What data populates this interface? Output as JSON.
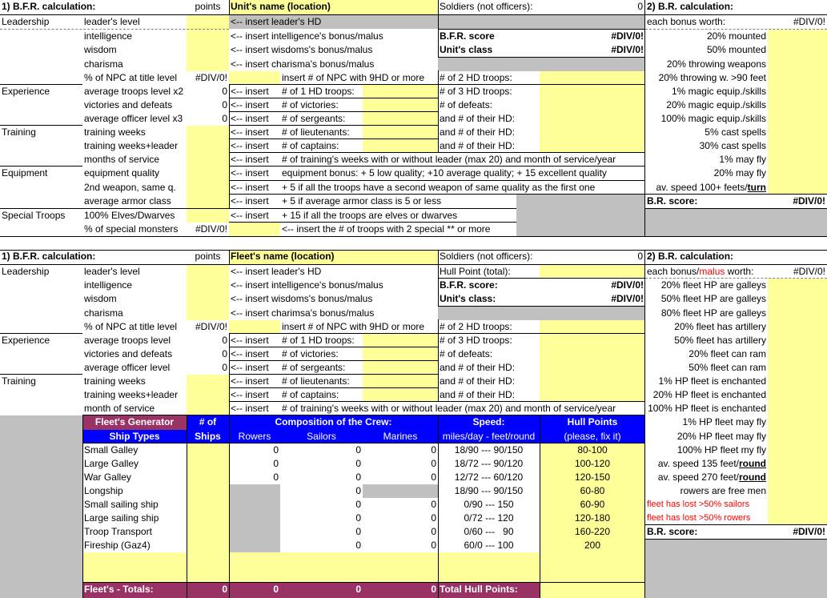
{
  "army": {
    "title": "1) B.F.R. calculation:",
    "points_header": "points",
    "unit_name": "Unit's name (location)",
    "soldiers_label": "Soldiers (not officers):",
    "soldiers_value": "0",
    "br_title": "2) B.R. calculation:",
    "bonus_worth_label": "each bonus worth:",
    "bonus_worth_value": "#DIV/0!",
    "cat_leadership": "Leadership",
    "cat_experience": "Experience",
    "cat_training": "Training",
    "cat_equipment": "Equipment",
    "cat_special": "Special Troops",
    "rows": {
      "leaders_level": "leader's level",
      "intelligence": "intelligence",
      "wisdom": "wisdom",
      "charisma": "charisma",
      "npc_pct": "% of NPC at title level",
      "npc_pct_val": "#DIV/0!",
      "avg_troops": "average troops level x2",
      "avg_troops_val": "0",
      "victories": "victories and defeats",
      "victories_val": "0",
      "avg_officer": "average officer level x3",
      "avg_officer_val": "0",
      "train_weeks": "training weeks",
      "train_weeks_leader": "training weeks+leader",
      "months": "months of service",
      "equip_quality": "equipment quality",
      "second_weapon": "2nd weapon, same q.",
      "avg_armor": "average armor class",
      "elves": "100% Elves/Dwarves",
      "special_monsters": "% of special monsters",
      "special_monsters_val": "#DIV/0!"
    },
    "inserts": {
      "leader_hd": "<-- insert leader's HD",
      "int_bonus": "<-- insert intelligence's bonus/malus",
      "wis_bonus": "<-- insert wisdoms's bonus/malus",
      "cha_bonus": "<-- insert charisma's bonus/malus",
      "npc_9hd": "insert # of NPC with 9HD or more",
      "insert": "<-- insert",
      "hd1": "# of 1 HD troops:",
      "victories": "# of victories:",
      "sergeants": "# of sergeants:",
      "lieutenants": "# of lieutenants:",
      "captains": "# of captains:",
      "training_weeks": "# of training's weeks with or without leader (max 20) and month of service/year",
      "equip_bonus": "equipment bonus: + 5 low quality; +10 average quality; + 15 excellent quality",
      "second_weapon": "+ 5 if all the troops have a second weapon of same quality as the first one",
      "armor": "+ 5 if average armor class is 5 or less",
      "elves": "+ 15 if all the troops are elves or dwarves",
      "special": "<-- insert the # of troops with 2 special ** or more"
    },
    "right": {
      "bfr_score": "B.F.R. score",
      "bfr_score_val": "#DIV/0!",
      "unit_class": "Unit's class",
      "unit_class_val": "#DIV/0!",
      "hd2": "# of 2 HD troops:",
      "hd3": "# of 3 HD troops:",
      "defeats": "# of defeats:",
      "their_hd": "and # of their HD:"
    },
    "br_items": [
      "20% mounted",
      "50% mounted",
      "20% throwing weapons",
      "20% throwing w. >90 feet",
      "1% magic equip./skills",
      "20% magic equip./skills",
      "100% magic equip./skills",
      "5% cast spells",
      "30% cast spells",
      "1% may fly",
      "20% may fly"
    ],
    "av_speed_prefix": "av. speed 100+ feets/",
    "av_speed_turn": "turn",
    "br_score": "B.R. score:",
    "br_score_val": "#DIV/0!"
  },
  "fleet": {
    "title": "1) B.F.R. calculation:",
    "points_header": "points",
    "fleet_name": "Fleet's name (location)",
    "soldiers_label": "Soldiers (not officers):",
    "soldiers_value": "0",
    "hull_point_label": "Hull Point (total):",
    "br_title": "2) B.R. calculation:",
    "bonus_prefix": "each bonus/",
    "bonus_malus": "malus",
    "bonus_suffix": " worth:",
    "bonus_value": "#DIV/0!",
    "cat_leadership": "Leadership",
    "cat_experience": "Experience",
    "cat_training": "Training",
    "rows": {
      "leaders_level": "leader's level",
      "intelligence": "intelligence",
      "wisdom": "wisdom",
      "charisma": "charisma",
      "npc_pct": "% of NPC at title level",
      "npc_pct_val": "#DIV/0!",
      "avg_troops": "average troops level",
      "avg_troops_val": "0",
      "victories": "victories and defeats",
      "victories_val": "0",
      "avg_officer": "average officer level",
      "avg_officer_val": "0",
      "train_weeks": "training weeks",
      "train_weeks_leader": "training weeks+leader",
      "month": "month of service"
    },
    "inserts": {
      "leader_hd": "<-- insert leader's HD",
      "int_bonus": "<-- insert intelligence's bonus/malus",
      "wis_bonus": "<-- insert wisdoms's bonus/malus",
      "cha_bonus": "<-- insert charimsa's bonus/malus",
      "npc_9hd": "insert # of NPC with 9HD or more",
      "insert": "<-- insert",
      "hd1": "# of 1 HD troops:",
      "victories": "# of victories:",
      "sergeants": "# of sergeants:",
      "lieutenants": "# of lieutenants:",
      "captains": "# of captains:",
      "training_weeks": "# of training's weeks with or without leader (max 20) and month of service/year"
    },
    "right": {
      "bfr_score": "B.F.R. score:",
      "bfr_score_val": "#DIV/0!",
      "unit_class": "Unit's class:",
      "unit_class_val": "#DIV/0!",
      "hd2": "# of 2 HD troops:",
      "hd3": "# of 3 HD troops:",
      "defeats": "# of defeats:",
      "their_hd": "and # of their HD:"
    },
    "br_items": [
      "20% fleet HP are galleys",
      "50% fleet HP are galleys",
      "80% fleet HP are galleys",
      "20% fleet has artillery",
      "50% fleet has artillery",
      "20% fleet can ram",
      "50% fleet can ram",
      "1% HP fleet is enchanted",
      "20% HP fleet is enchanted",
      "100% HP fleet is enchanted",
      "1% HP fleet may fly",
      "20% HP fleet may fly",
      "100% HP fleet my fly"
    ],
    "speed135_prefix": "av. speed 135 feet/",
    "speed270_prefix": "av. speed 270 feet/",
    "round": "round",
    "rowers_free": "rowers are free men",
    "lost_sailors": "fleet has lost >50% sailors",
    "lost_rowers": "fleet has lost >50% rowers",
    "br_score": "B.R. score:",
    "br_score_val": "#DIV/0!"
  },
  "generator": {
    "title": "Fleet's Generator",
    "num_of": "# of",
    "ships": "Ships",
    "ship_types": "Ship Types",
    "composition": "Composition of the Crew:",
    "rowers": "Rowers",
    "sailors": "Sailors",
    "marines": "Marines",
    "speed": "Speed:",
    "speed_units": "miles/day - feet/round",
    "hull_points": "Hull Points",
    "fix_it": "(please, fix it)",
    "ships_list": [
      {
        "name": "Small Galley",
        "rowers": "0",
        "sailors": "0",
        "marines": "0",
        "speed": "18/90 --- 90/150",
        "hull": "80-100"
      },
      {
        "name": "Large Galley",
        "rowers": "0",
        "sailors": "0",
        "marines": "0",
        "speed": "18/72 --- 90/120",
        "hull": "100-120"
      },
      {
        "name": "War Galley",
        "rowers": "0",
        "sailors": "0",
        "marines": "0",
        "speed": "12/72 --- 60/120",
        "hull": "120-150"
      },
      {
        "name": "Longship",
        "rowers": "",
        "sailors": "0",
        "marines": "",
        "speed": "18/90 --- 90/150",
        "hull": "60-80"
      },
      {
        "name": "Small sailing ship",
        "rowers": "",
        "sailors": "0",
        "marines": "0",
        "speed": "0/90 --- 150",
        "hull": "60-90"
      },
      {
        "name": "Large sailing ship",
        "rowers": "",
        "sailors": "0",
        "marines": "0",
        "speed": "0/72 --- 120",
        "hull": "120-180"
      },
      {
        "name": "Troop Transport",
        "rowers": "",
        "sailors": "0",
        "marines": "0",
        "speed": "0/60 ---   90",
        "hull": "160-220"
      },
      {
        "name": "Fireship (Gaz4)",
        "rowers": "",
        "sailors": "0",
        "marines": "0",
        "speed": "60/0 --- 100",
        "hull": "200"
      }
    ],
    "totals_label": "Fleet's - Totals:",
    "total_ships": "0",
    "total_rowers": "0",
    "total_sailors": "0",
    "total_marines": "0",
    "total_hull_label": "Total Hull Points:"
  }
}
